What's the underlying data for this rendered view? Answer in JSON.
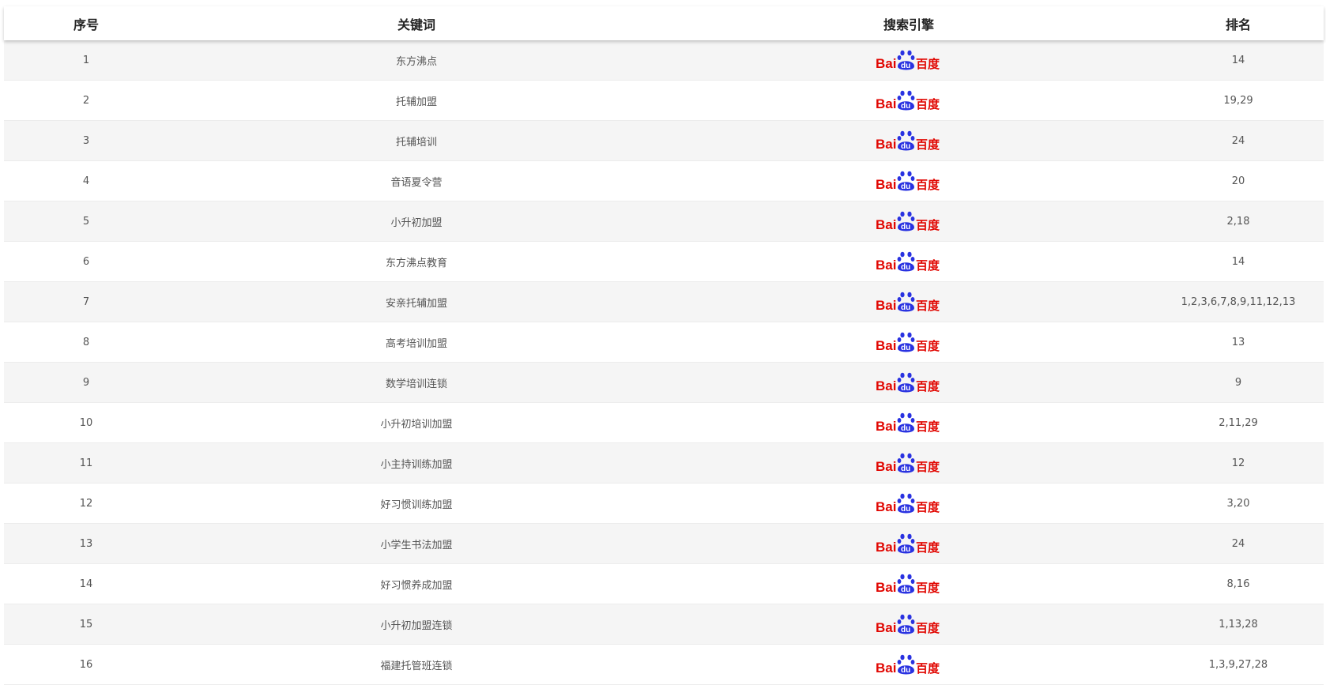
{
  "header": {
    "index_label": "序号",
    "keyword_label": "关键词",
    "engine_label": "搜索引擎",
    "rank_label": "排名"
  },
  "engine_logo": {
    "icon": "baidu-logo-icon",
    "text_bai": "Bai",
    "text_du": "du",
    "text_cn": "百度",
    "red": "#e10601",
    "blue": "#2932e1"
  },
  "rows": [
    {
      "index": "1",
      "keyword": "东方沸点",
      "rank": "14"
    },
    {
      "index": "2",
      "keyword": "托辅加盟",
      "rank": "19,29"
    },
    {
      "index": "3",
      "keyword": "托辅培训",
      "rank": "24"
    },
    {
      "index": "4",
      "keyword": "音语夏令营",
      "rank": "20"
    },
    {
      "index": "5",
      "keyword": "小升初加盟",
      "rank": "2,18"
    },
    {
      "index": "6",
      "keyword": "东方沸点教育",
      "rank": "14"
    },
    {
      "index": "7",
      "keyword": "安亲托辅加盟",
      "rank": "1,2,3,6,7,8,9,11,12,13"
    },
    {
      "index": "8",
      "keyword": "高考培训加盟",
      "rank": "13"
    },
    {
      "index": "9",
      "keyword": "数学培训连锁",
      "rank": "9"
    },
    {
      "index": "10",
      "keyword": "小升初培训加盟",
      "rank": "2,11,29"
    },
    {
      "index": "11",
      "keyword": "小主持训练加盟",
      "rank": "12"
    },
    {
      "index": "12",
      "keyword": "好习惯训练加盟",
      "rank": "3,20"
    },
    {
      "index": "13",
      "keyword": "小学生书法加盟",
      "rank": "24"
    },
    {
      "index": "14",
      "keyword": "好习惯养成加盟",
      "rank": "8,16"
    },
    {
      "index": "15",
      "keyword": "小升初加盟连锁",
      "rank": "1,13,28"
    },
    {
      "index": "16",
      "keyword": "福建托管班连锁",
      "rank": "1,3,9,27,28"
    }
  ]
}
